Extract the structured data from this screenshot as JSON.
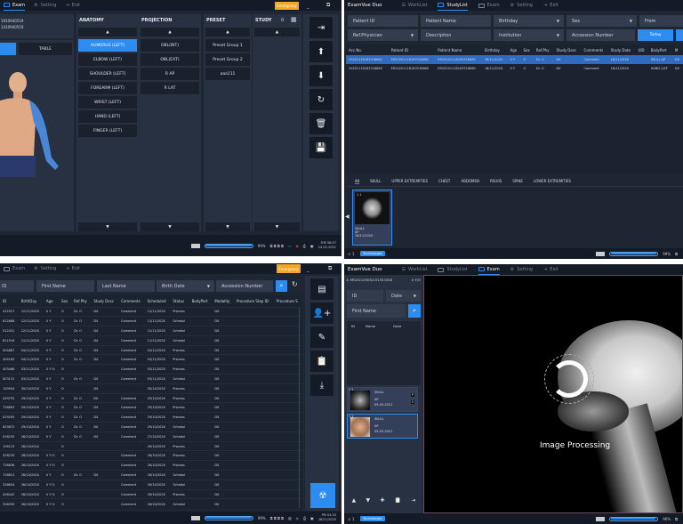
{
  "colors": {
    "accent": "#2d8cf0",
    "emergency": "#f5a623",
    "background": "#1e2533"
  },
  "q1": {
    "tabs": [
      "Exam",
      "Setting",
      "Exit"
    ],
    "emergency": "Emergency",
    "patient_ids": [
      "1910940519",
      "1410940519"
    ],
    "view_toggle": [
      "",
      "TABLE"
    ],
    "anatomy": {
      "title": "ANATOMY",
      "items": [
        "HUMERUS (LEFT)",
        "ELBOW (LEFT)",
        "SHOULDER (LEFT)",
        "FOREARM (LEFT)",
        "WRIST (LEFT)",
        "HAND (LEFT)",
        "FINGER (LEFT)"
      ],
      "selected": 0
    },
    "projection": {
      "title": "PROJECTION",
      "items": [
        "OBL(INT)",
        "OBL(EXT)",
        "R AP",
        "R LAT"
      ]
    },
    "preset": {
      "title": "PRESET",
      "items": [
        "Preset Group 1",
        "Preset Group 2",
        "aaa111"
      ]
    },
    "study": {
      "title": "STUDY",
      "count": "0"
    },
    "disk_percent": "99%",
    "disk_fill": 0.99,
    "time": "오후 08:07",
    "date": "24-02-2021"
  },
  "q2": {
    "app_title": "ExamVue Duo",
    "tabs": [
      "WorkList",
      "StudyList",
      "Exam",
      "Setting",
      "Exit"
    ],
    "filters": {
      "patient_id": "Patient ID",
      "patient_name": "Patient Name",
      "birthday": "Birthday",
      "sex": "Sex",
      "from": "From",
      "ref_physician": "Ref.Physician",
      "description": "Description",
      "institution": "Institution",
      "accession": "Accession Number",
      "today": "Today"
    },
    "columns": [
      "Acc.No.",
      "Patient ID",
      "Patient Name",
      "Birthday",
      "Age",
      "Sex",
      "Ref.Phy",
      "Study Desc",
      "Comments",
      "Study Date",
      "UID",
      "BodyPart",
      "M"
    ],
    "rows": [
      [
        "20201118163318662",
        "ER20201118163318662",
        "ER20201118163318662",
        "18/11/202X",
        "0 Y",
        "O",
        "Dr. O",
        "DX",
        "Comment",
        "18/11/202X",
        "",
        "SKULL AP",
        "DX"
      ],
      [
        "20201118163318860",
        "ER20201118163318860",
        "ER20201118163318860",
        "18/11/202X",
        "0 Y",
        "O",
        "Dr. O",
        "DX",
        "Comment",
        "18/11/202X",
        "",
        "HAND (LEF",
        "DX"
      ]
    ],
    "body_tabs": [
      "All",
      "SKULL",
      "UPPER EXTREMITIES",
      "CHEST",
      "ABDOMEN",
      "PELVIS",
      "SPINE",
      "LOWER EXTREMITIES"
    ],
    "thumb": {
      "index": "1 1",
      "lines": [
        "SKULL",
        "AP",
        "18/11/2020"
      ]
    },
    "user_count": "1",
    "role": "Technologist",
    "disk_percent": "99%",
    "disk_fill": 0.99
  },
  "q3": {
    "tabs": [
      "Exam",
      "Setting",
      "Exit"
    ],
    "emergency": "Emergency",
    "filters": {
      "id": "ID",
      "first_name": "First Name",
      "last_name": "Last Name",
      "birth_date": "Birth Date",
      "accession": "Accession Number"
    },
    "columns": [
      "ID",
      "BirthDay",
      "Age",
      "Sex",
      "Ref.Phy",
      "Study Desc",
      "Comments",
      "Scheduled",
      "Status",
      "BodyPart",
      "Modality",
      "Procedure Step ID",
      "Procedure S"
    ],
    "rows": [
      [
        "412527",
        "12/11/202X",
        "0 Y",
        "O",
        "Dr. O",
        "DX",
        "Comment",
        "12/11/202X",
        "Process",
        "",
        "DX",
        "",
        ""
      ],
      [
        "612868",
        "12/11/202X",
        "0 Y",
        "O",
        "Dr. O",
        "DX",
        "Comment",
        "12/11/202X",
        "Schedul",
        "",
        "DX",
        "",
        ""
      ],
      [
        "512431",
        "12/11/202X",
        "0 Y",
        "O",
        "Dr. O",
        "DX",
        "Comment",
        "12/11/202X",
        "Schedul",
        "",
        "DX",
        "",
        ""
      ],
      [
        "811516",
        "11/11/202X",
        "0 Y",
        "O",
        "Dr. O",
        "DX",
        "Comment",
        "11/11/202X",
        "Schedul",
        "",
        "DX",
        "",
        ""
      ],
      [
        "004887",
        "04/11/202X",
        "0 Y",
        "O",
        "Dr. O",
        "DX",
        "Comment",
        "04/11/202X",
        "Process",
        "",
        "DX",
        "",
        ""
      ],
      [
        "404162",
        "04/11/202X",
        "0 Y",
        "O",
        "Dr. O",
        "DX",
        "Comment",
        "04/11/202X",
        "Process",
        "",
        "DX",
        "",
        ""
      ],
      [
        "403468",
        "03/11/202X",
        "0 Y 0:",
        "O",
        "",
        "",
        "Comment",
        "03/11/202X",
        "Process",
        "",
        "DX",
        "",
        ""
      ],
      [
        "003131",
        "03/11/202X",
        "0 Y",
        "O",
        "Dr. O",
        "DX",
        "Comment",
        "03/11/202X",
        "Schedul",
        "",
        "DX",
        "",
        ""
      ],
      [
        "100954",
        "30/10/202X",
        "0 Y",
        "O",
        "",
        "DX",
        "",
        "30/10/202X",
        "Process",
        "",
        "DX",
        "",
        ""
      ],
      [
        "029755",
        "29/10/202X",
        "0 Y",
        "O",
        "Dr. O",
        "DX",
        "Comment",
        "29/10/202X",
        "Process",
        "",
        "DX",
        "",
        ""
      ],
      [
        "728893",
        "29/10/202X",
        "0 Y",
        "O",
        "Dr. O",
        "DX",
        "Comment",
        "29/10/202X",
        "Process",
        "",
        "DX",
        "",
        ""
      ],
      [
        "029295",
        "29/10/202X",
        "0 Y",
        "O",
        "Dr. O",
        "DX",
        "Comment",
        "29/10/202X",
        "Process",
        "",
        "DX",
        "",
        ""
      ],
      [
        "629872",
        "29/10/202X",
        "0 Y",
        "O",
        "Dr. O",
        "DX",
        "Comment",
        "29/10/202X",
        "Schedul",
        "",
        "DX",
        "",
        ""
      ],
      [
        "026235",
        "26/10/202X",
        "0 Y",
        "O",
        "Dr. O",
        "DX",
        "Comment",
        "27/10/202X",
        "Schedul",
        "",
        "DX",
        "",
        ""
      ],
      [
        "126123",
        "26/10/202X",
        "",
        "O",
        "",
        "",
        "",
        "26/10/202X",
        "Process",
        "",
        "DX",
        "",
        ""
      ],
      [
        "026235",
        "26/10/202X",
        "0 Y 0:",
        "O",
        "",
        "",
        "Comment",
        "26/10/202X",
        "Process",
        "",
        "DX",
        "",
        ""
      ],
      [
        "726836",
        "26/10/202X",
        "0 Y 0:",
        "O",
        "",
        "",
        "Comment",
        "26/10/202X",
        "Process",
        "",
        "DX",
        "",
        ""
      ],
      [
        "726811",
        "26/10/202X",
        "0 Y",
        "O",
        "Dr. O",
        "DX",
        "Comment",
        "26/10/202X",
        "Schedul",
        "",
        "DX",
        "",
        ""
      ],
      [
        "326634",
        "26/10/202X",
        "0 Y 0:",
        "O",
        "",
        "",
        "Comment",
        "26/10/202X",
        "Schedul",
        "",
        "DX",
        "",
        ""
      ],
      [
        "426442",
        "26/10/202X",
        "0 Y 0:",
        "O",
        "",
        "",
        "Comment",
        "26/10/202X",
        "Process",
        "",
        "DX",
        "",
        ""
      ],
      [
        "326330",
        "26/10/202X",
        "0 Y 0:",
        "O",
        "",
        "",
        "Comment",
        "26/10/202X",
        "Schedul",
        "",
        "DX",
        "",
        ""
      ]
    ],
    "disk_percent": "99%",
    "disk_fill": 0.99,
    "time": "PM 04:32",
    "date": "28/11/2020"
  },
  "q4": {
    "app_title": "ExamVue Duo",
    "tabs": [
      "WorkList",
      "StudyList",
      "Exam",
      "Setting",
      "Exit"
    ],
    "patient": "ER20210305/131353358",
    "age": "0 Y/O",
    "filters": {
      "id": "ID",
      "date": "Date",
      "first_name": "First Name"
    },
    "list_columns": [
      "ID",
      "Name",
      "Date"
    ],
    "thumbs": [
      {
        "index": "1 1",
        "lines": [
          "SKULL",
          "AP",
          "05-03-2021"
        ],
        "badges": [
          "P",
          "S"
        ]
      },
      {
        "index": "1 2",
        "lines": [
          "SKULL",
          "AP",
          "05-03-2021"
        ],
        "badges": []
      }
    ],
    "processing": "Image Processing",
    "user_count": "1",
    "role": "Technologist",
    "disk_percent": "96%",
    "disk_fill": 0.96
  }
}
